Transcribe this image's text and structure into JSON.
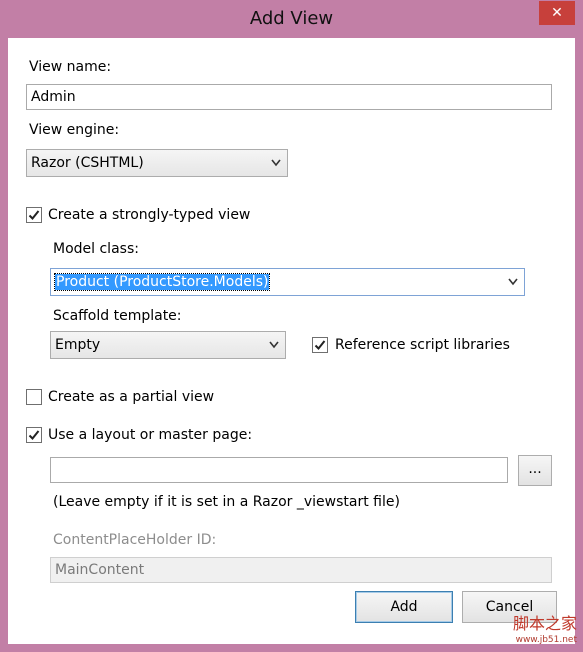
{
  "window": {
    "title": "Add View",
    "close_glyph": "✕"
  },
  "view_name": {
    "label": "View name:",
    "value": "Admin"
  },
  "view_engine": {
    "label": "View engine:",
    "selected": "Razor (CSHTML)"
  },
  "strongly_typed": {
    "label": "Create a strongly-typed view",
    "checked": true
  },
  "model_class": {
    "label": "Model class:",
    "selected": "Product (ProductStore.Models)"
  },
  "scaffold_template": {
    "label": "Scaffold template:",
    "selected": "Empty"
  },
  "reference_scripts": {
    "label": "Reference script libraries",
    "checked": true
  },
  "partial_view": {
    "label": "Create as a partial view",
    "checked": false
  },
  "layout": {
    "label": "Use a layout or master page:",
    "checked": true,
    "value": "",
    "browse_label": "...",
    "hint": "(Leave empty if it is set in a Razor _viewstart file)"
  },
  "content_placeholder": {
    "label": "ContentPlaceHolder ID:",
    "value": "MainContent"
  },
  "buttons": {
    "add": "Add",
    "cancel": "Cancel"
  },
  "watermark": {
    "line1": "脚本之家",
    "line2": "www.jb51.net"
  },
  "icons": {
    "check": "checkmark-icon",
    "dropdown": "chevron-down-icon",
    "close": "close-icon"
  }
}
